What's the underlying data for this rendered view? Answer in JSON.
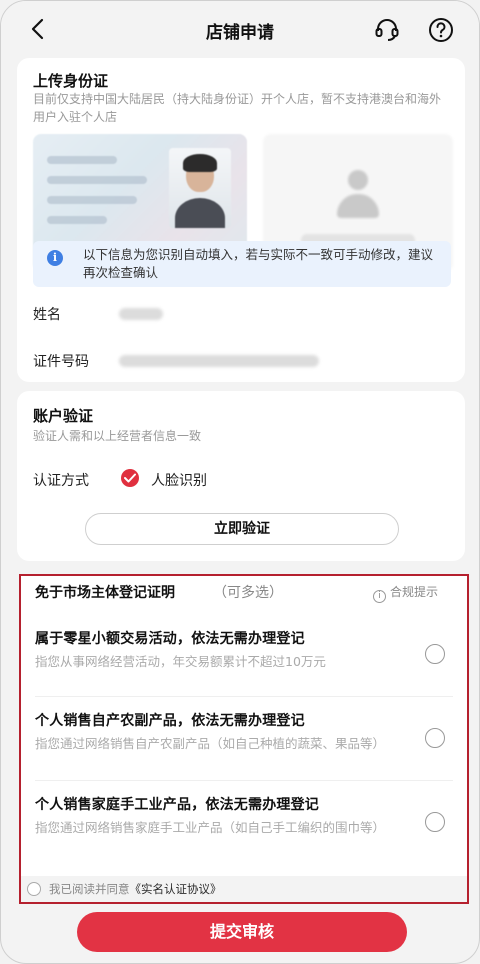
{
  "header": {
    "title": "店铺申请"
  },
  "id_section": {
    "title": "上传身份证",
    "description": "目前仅支持中国大陆居民（持大陆身份证）开个人店，暂不支持港澳台和海外用户入驻个人店",
    "info_text": "以下信息为您识别自动填入，若与实际不一致可手动修改，建议再次检查确认",
    "name_label": "姓名",
    "id_number_label": "证件号码"
  },
  "account_section": {
    "title": "账户验证",
    "description": "验证人需和以上经营者信息一致",
    "auth_label": "认证方式",
    "auth_method": "人脸识别",
    "verify_button": "立即验证"
  },
  "exempt_section": {
    "title": "免于市场主体登记证明",
    "subtitle": "（可多选）",
    "compliance_hint": "合规提示",
    "options": [
      {
        "title": "属于零星小额交易活动，依法无需办理登记",
        "description": "指您从事网络经营活动，年交易额累计不超过10万元"
      },
      {
        "title": "个人销售自产农副产品，依法无需办理登记",
        "description": "指您通过网络销售自产农副产品（如自己种植的蔬菜、果品等）"
      },
      {
        "title": "个人销售家庭手工业产品，依法无需办理登记",
        "description": "指您通过网络销售家庭手工业产品（如自己手工编织的围巾等）"
      }
    ],
    "agreement_prefix": "我已阅读并同意",
    "agreement_link": "《实名认证协议》"
  },
  "footer": {
    "submit_button": "提交审核"
  },
  "colors": {
    "accent": "#e23344",
    "highlight_border": "#b5202e",
    "info_blue": "#3f7fe3"
  }
}
